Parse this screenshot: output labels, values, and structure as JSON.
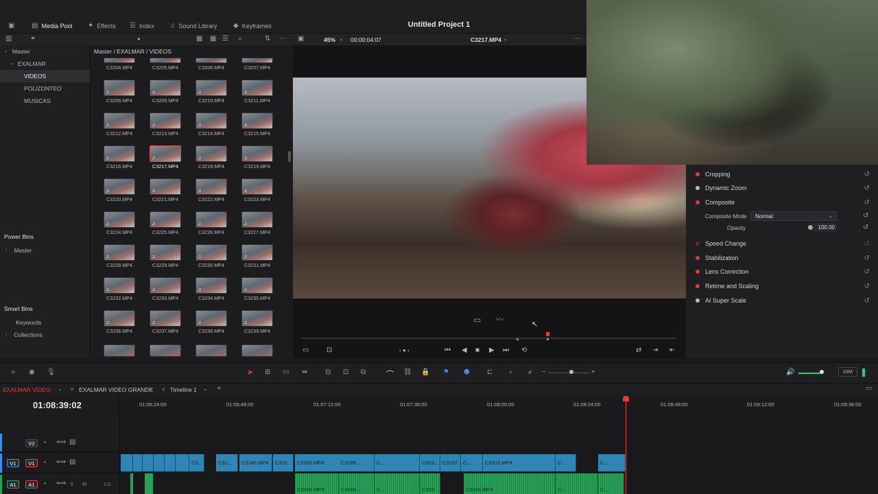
{
  "tabs": {
    "media_pool": "Media Pool",
    "effects": "Effects",
    "index": "Index",
    "sound_library": "Sound Library",
    "keyframes": "Keyframes"
  },
  "project_title": "Untitled Project 1",
  "viewer": {
    "zoom": "45%",
    "timecode": "00:00:04:07",
    "clip_name": "C3217.MP4"
  },
  "breadcrumb": "Master / EXALMAR / VIDEOS",
  "bins": {
    "master": "Master",
    "exalmar": "EXALMAR",
    "videos": "VIDEOS",
    "polizonteo": "POLIZONTEO",
    "musicas": "MUSICAS",
    "power_bins": "Power Bins",
    "power_master": "Master",
    "smart_bins": "Smart Bins",
    "keywords": "Keywords",
    "collections": "Collections"
  },
  "clips": [
    "C3204.MP4",
    "C3205.MP4",
    "C3206.MP4",
    "C3207.MP4",
    "C3208.MP4",
    "C3209.MP4",
    "C3210.MP4",
    "C3211.MP4",
    "C3212.MP4",
    "C3213.MP4",
    "C3214.MP4",
    "C3215.MP4",
    "C3216.MP4",
    "C3217.MP4",
    "C3218.MP4",
    "C3219.MP4",
    "C3220.MP4",
    "C3221.MP4",
    "C3222.MP4",
    "C3223.MP4",
    "C3224.MP4",
    "C3225.MP4",
    "C3226.MP4",
    "C3227.MP4",
    "C3228.MP4",
    "C3229.MP4",
    "C3230.MP4",
    "C3231.MP4",
    "C3232.MP4",
    "C3233.MP4",
    "C3234.MP4",
    "C3235.MP4",
    "C3236.MP4",
    "C3237.MP4",
    "C3238.MP4",
    "C3239.MP4"
  ],
  "selected_clip": "C3217.MP4",
  "inspector": {
    "cropping": "Cropping",
    "dynamic_zoom": "Dynamic Zoom",
    "composite": "Composite",
    "composite_mode_label": "Composite Mode",
    "composite_mode_value": "Normal",
    "opacity_label": "Opacity",
    "opacity_value": "100.00",
    "speed_change": "Speed Change",
    "stabilization": "Stabilization",
    "lens_correction": "Lens Correction",
    "retime_scaling": "Retime and Scaling",
    "ai_super_scale": "AI Super Scale"
  },
  "timeline": {
    "tabs": [
      "EXALMAR VIDEO",
      "EXALMAR VIDEO GRANDE",
      "Timeline 1"
    ],
    "timecode": "01:08:39:02",
    "ruler": [
      "01:06:24:00",
      "01:06:48:00",
      "01:07:12:00",
      "01:07:36:00",
      "01:08:00:00",
      "01:08:24:00",
      "01:08:48:00",
      "01:09:12:00",
      "01:09:36:00"
    ],
    "tracks": {
      "v2": "V2",
      "v1a": "V1",
      "v1b": "V1",
      "a1a": "A1",
      "a1b": "A1",
      "audio_level": "2.0",
      "solo": "S",
      "mute": "M"
    },
    "video_clips": [
      "C3...",
      "C31...",
      "C3146.MP4",
      "C316...",
      "C3165.MP4",
      "C3165...",
      "C...",
      "C319...",
      "C3197...",
      "C...",
      "C3203.MP4",
      "C...",
      "C..."
    ],
    "audio_clips": [
      "C3165.MP4",
      "C3165...",
      "C...",
      "C319...",
      "C3203.MP4",
      "C...",
      "C..."
    ],
    "dim_label": "DIM"
  },
  "colors": {
    "accent_red": "#e63b3b",
    "video_clip": "#2f86b5",
    "audio_clip": "#2aa35a"
  }
}
